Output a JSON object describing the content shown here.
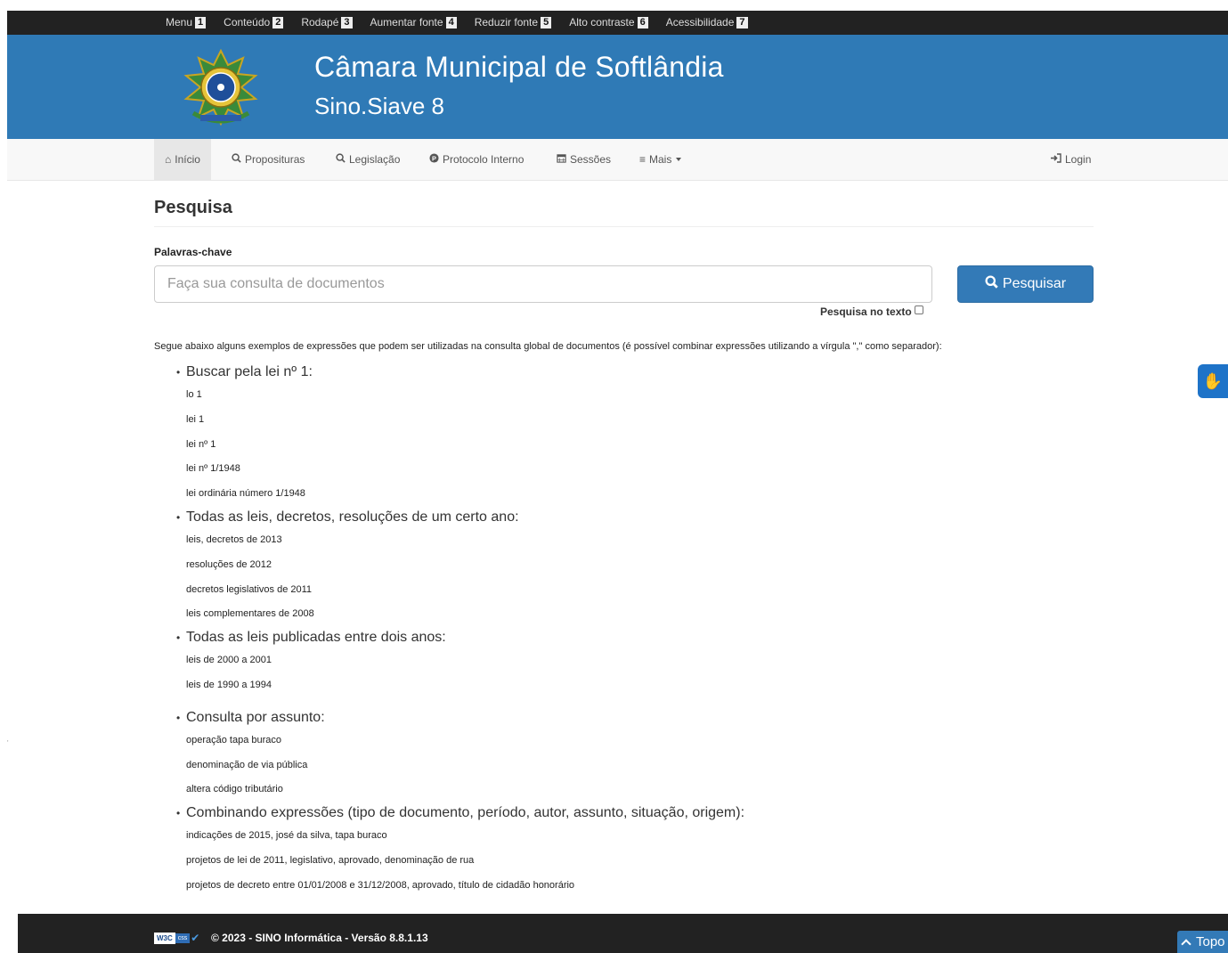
{
  "accessibility_bar": {
    "items": [
      {
        "label": "Menu",
        "key": "1"
      },
      {
        "label": "Conteúdo",
        "key": "2"
      },
      {
        "label": "Rodapé",
        "key": "3"
      },
      {
        "label": "Aumentar fonte",
        "key": "4"
      },
      {
        "label": "Reduzir fonte",
        "key": "5"
      },
      {
        "label": "Alto contraste",
        "key": "6"
      },
      {
        "label": "Acessibilidade",
        "key": "7"
      }
    ]
  },
  "header": {
    "title": "Câmara Municipal de Softlândia",
    "subtitle": "Sino.Siave 8",
    "logo_icon": "brasao-icon"
  },
  "navbar": {
    "items": [
      {
        "label": "Início",
        "icon": "home-icon"
      },
      {
        "label": "Proposituras",
        "icon": "search-icon"
      },
      {
        "label": "Legislação",
        "icon": "search-icon"
      },
      {
        "label": "Protocolo Interno",
        "icon": "protocol-icon"
      },
      {
        "label": "Sessões",
        "icon": "calendar-icon"
      },
      {
        "label": "Mais",
        "icon": "menu-icon"
      }
    ],
    "login": "Login"
  },
  "search": {
    "heading": "Pesquisa",
    "keywords_label": "Palavras-chave",
    "placeholder": "Faça sua consulta de documentos",
    "button": "Pesquisar",
    "fulltext_label": "Pesquisa no texto"
  },
  "examples": {
    "intro": "Segue abaixo alguns exemplos de expressões que podem ser utilizadas na consulta global de documentos (é possível combinar expressões utilizando a vírgula \",\" como separador):",
    "groups": [
      {
        "title": "Buscar pela lei nº 1:",
        "items": [
          "lo 1",
          "lei 1",
          "lei nº 1",
          "lei nº 1/1948",
          "lei ordinária número 1/1948"
        ]
      },
      {
        "title": "Todas as leis, decretos, resoluções de um certo ano:",
        "items": [
          "leis, decretos de 2013",
          "resoluções de 2012",
          "decretos legislativos de 2011",
          "leis complementares de 2008"
        ]
      },
      {
        "title": "Todas as leis publicadas entre dois anos:",
        "items": [
          "leis de 2000 a 2001",
          "leis de 1990 a 1994"
        ]
      },
      {
        "title": "Consulta por assunto:",
        "items": [
          "operação tapa buraco",
          "denominação de via pública",
          "altera código tributário"
        ]
      },
      {
        "title": "Combinando expressões (tipo de documento, período, autor, assunto, situação, origem):",
        "items": [
          "indicações de 2015, josé da silva, tapa buraco",
          "projetos de lei de 2011, legislativo, aprovado, denominação de rua",
          "projetos de decreto entre 01/01/2008 e 31/12/2008, aprovado, título de cidadão honorário"
        ]
      }
    ]
  },
  "footer": {
    "w3c": "W3C",
    "css": "css",
    "copyright": "© 2023 - SINO Informática - Versão 8.8.1.13",
    "top_button": "Topo"
  },
  "colors": {
    "header_bg": "#2f7ab6",
    "button_bg": "#337ab7",
    "bar_bg": "#222222"
  }
}
